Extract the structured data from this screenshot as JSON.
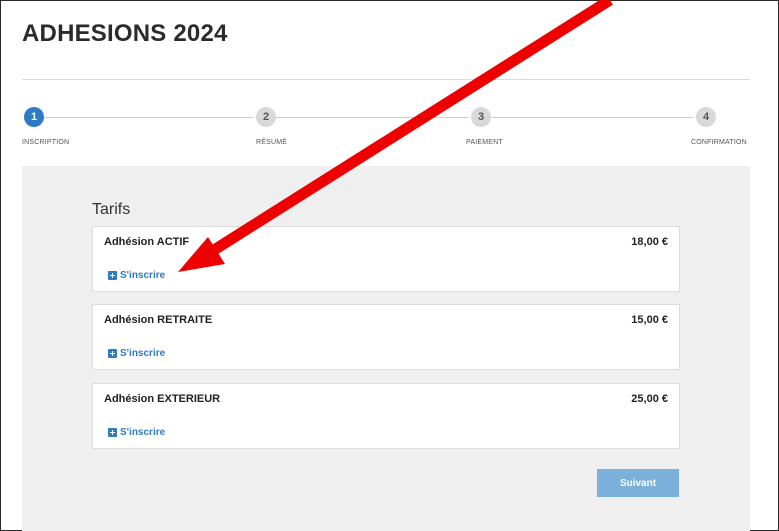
{
  "page": {
    "title": "ADHESIONS 2024"
  },
  "stepper": {
    "steps": [
      {
        "number": "1",
        "label": "INSCRIPTION",
        "active": true
      },
      {
        "number": "2",
        "label": "RÉSUMÉ",
        "active": false
      },
      {
        "number": "3",
        "label": "PAIEMENT",
        "active": false
      },
      {
        "number": "4",
        "label": "CONFIRMATION",
        "active": false
      }
    ]
  },
  "tarifs": {
    "heading": "Tarifs",
    "items": [
      {
        "name": "Adhésion ACTIF",
        "price": "18,00 €",
        "action_label": "S'inscrire"
      },
      {
        "name": "Adhésion RETRAITE",
        "price": "15,00 €",
        "action_label": "S'inscrire"
      },
      {
        "name": "Adhésion EXTERIEUR",
        "price": "25,00 €",
        "action_label": "S'inscrire"
      }
    ]
  },
  "footer": {
    "next_label": "Suivant"
  },
  "colors": {
    "accent": "#2d7bc4",
    "next_button": "#7ab0d9",
    "annotation_arrow": "#ee0000",
    "panel_bg": "#efefef"
  }
}
